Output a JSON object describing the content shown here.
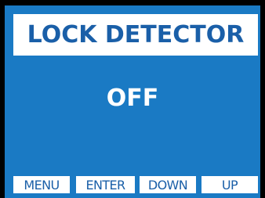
{
  "screen": {
    "title": "LOCK DETECTOR",
    "status": "OFF"
  },
  "softkeys": {
    "menu": "MENU",
    "enter": "ENTER",
    "down": "DOWN",
    "up": "UP"
  },
  "colors": {
    "screen_background": "#1a7ac4",
    "frame": "#000000",
    "label_background": "#ffffff",
    "label_text": "#1a5fa8",
    "status_text": "#ffffff"
  }
}
